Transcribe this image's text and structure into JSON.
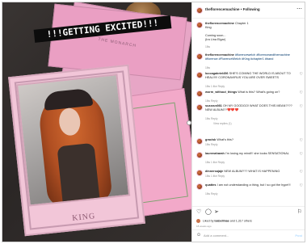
{
  "photo": {
    "banner_text": "!!!GETTING EXCITED!!!",
    "envelope_text": "THE MONARCH",
    "card_label": "KING"
  },
  "header": {
    "username": "theflorencemachine",
    "separator": "•",
    "follow_label": "Following",
    "more_icon": "more-icon"
  },
  "caption": {
    "username": "theflorencemachine",
    "text": "Chapter 1",
    "lines": [
      "King",
      "Coming soon...",
      "(Ira Lina Elgar)"
    ],
    "meta": "18w"
  },
  "comments": [
    {
      "user": "theflorencemachine",
      "text": "#florencewelch #florenceandthemachine #florence #FlorenceWelch #King #chapter1 #band",
      "meta": "18w"
    },
    {
      "user": "luccagabriel456",
      "text": "SHE'S COMING THE WORLD IS ABOUT TO HEAL!!!!! CORONAVIRUS YOU ARE OVER SWEETS",
      "meta": "18w  1 like  Reply"
    },
    {
      "user": "worm_without_things",
      "text": "What is this? What's going on?",
      "meta": "18w  Reply"
    },
    {
      "user": "suzzzus981",
      "text": "OH MY GOODGO! WHAT DOES THIS MEAN???? NEW ALBUM??❤️❤️❤️",
      "meta": "18w  Reply",
      "replies": "View replies (1)"
    },
    {
      "user": "gracisk",
      "text": "What's this?",
      "meta": "18w  Reply"
    },
    {
      "user": "laurenaharah",
      "text": "I'm losing my mind!!! she looks SENSATIONAL",
      "meta": "18w  1 like  Reply"
    },
    {
      "user": "dinnersajaje",
      "text": "NEW ALBUM??? WHAT IS HAPPENING",
      "meta": "18w  1 like  Reply"
    },
    {
      "user": "quattes",
      "text": "I am not understanding a thing, but I so got the hype!!!",
      "meta": "18w  Reply"
    }
  ],
  "actions": {
    "like_icon": "heart-icon",
    "comment_icon": "comment-icon",
    "share_icon": "share-icon",
    "save_icon": "bookmark-icon"
  },
  "likes": {
    "prefix": "Liked by",
    "user": "isabellmae",
    "suffix": "and 1,317 others"
  },
  "timestamp": "18 weeks ago",
  "add_comment": {
    "placeholder": "Add a comment...",
    "post_label": "Post"
  }
}
